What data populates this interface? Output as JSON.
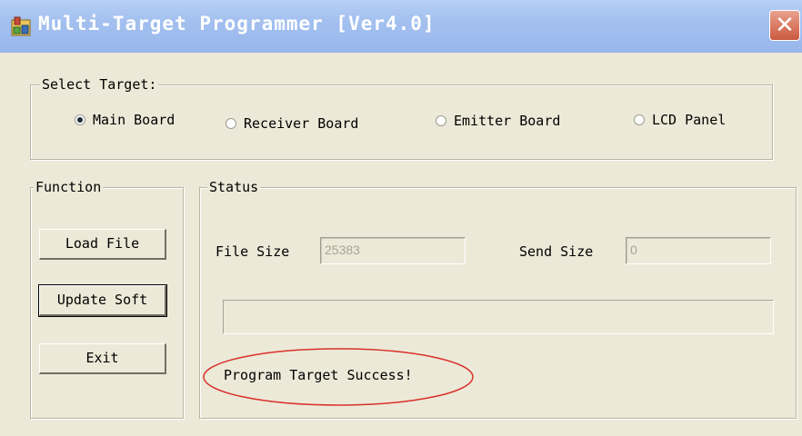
{
  "window": {
    "title": "Multi-Target Programmer [Ver4.0]",
    "close_glyph": "✕",
    "app_icon": "app-icon"
  },
  "select_target": {
    "legend": "Select Target:",
    "options": [
      {
        "label": "Main Board",
        "checked": true
      },
      {
        "label": "Receiver Board",
        "checked": false
      },
      {
        "label": "Emitter Board",
        "checked": false
      },
      {
        "label": "LCD Panel",
        "checked": false
      }
    ]
  },
  "function": {
    "legend": "Function",
    "buttons": {
      "load_file": "Load File",
      "update_soft": "Update Soft",
      "exit": "Exit"
    }
  },
  "status": {
    "legend": "Status",
    "file_size_label": "File Size",
    "file_size_value": "25383",
    "send_size_label": "Send Size",
    "send_size_value": "0",
    "progress_fraction": 0,
    "message": "Program Target Success!"
  },
  "colors": {
    "window_bg": "#ece9d8",
    "titlebar": "#a3c0ef",
    "close_button": "#d9785f",
    "annotation": "#d9312b"
  }
}
